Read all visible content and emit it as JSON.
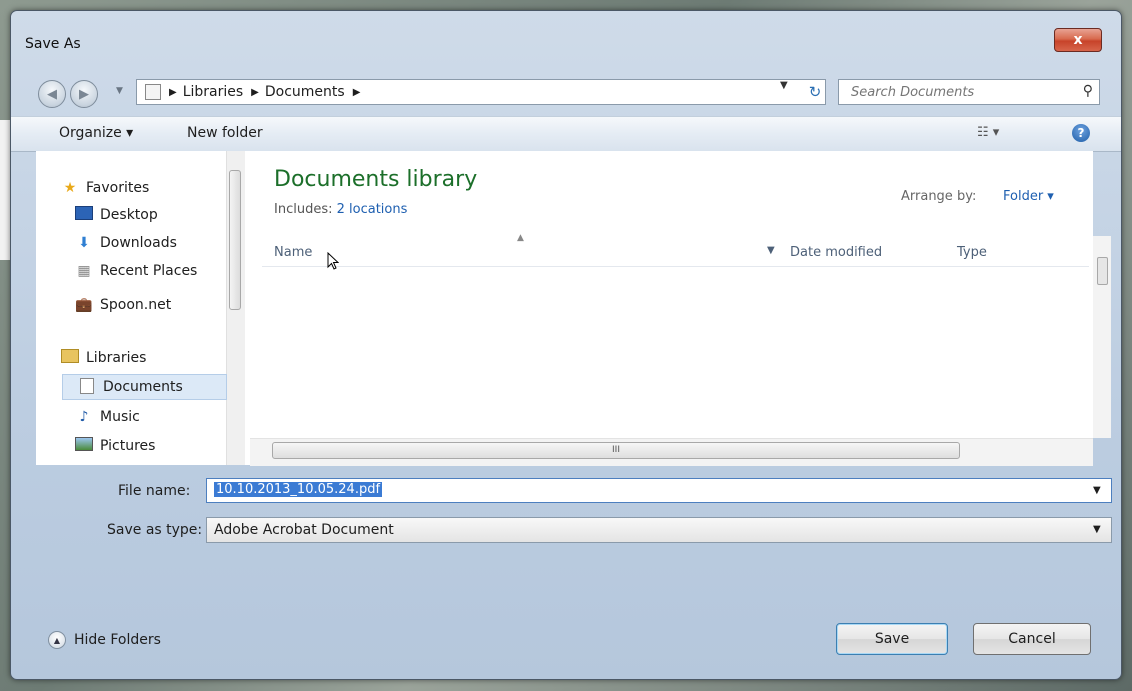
{
  "window": {
    "title": "Save As",
    "close_label": "x"
  },
  "address_bar": {
    "crumbs": [
      "Libraries",
      "Documents"
    ]
  },
  "search": {
    "placeholder": "Search Documents"
  },
  "toolbar": {
    "organize_label": "Organize ▾",
    "new_folder_label": "New folder"
  },
  "navigation": {
    "items": [
      {
        "label": "Favorites",
        "icon": "star-icon"
      },
      {
        "label": "Desktop",
        "icon": "desktop-icon"
      },
      {
        "label": "Downloads",
        "icon": "downloads-icon"
      },
      {
        "label": "Recent Places",
        "icon": "recent-places-icon"
      },
      {
        "label": "Spoon.net",
        "icon": "briefcase-icon"
      },
      {
        "label": "Libraries",
        "icon": "libraries-icon"
      },
      {
        "label": "Documents",
        "icon": "documents-icon",
        "selected": true
      },
      {
        "label": "Music",
        "icon": "music-icon"
      },
      {
        "label": "Pictures",
        "icon": "pictures-icon"
      }
    ]
  },
  "library": {
    "title": "Documents library",
    "includes_label": "Includes:",
    "includes_link": "2 locations",
    "arrange_label": "Arrange by:",
    "arrange_value": "Folder ▾"
  },
  "columns": [
    "Name",
    "Date modified",
    "Type"
  ],
  "form": {
    "file_name_label": "File name:",
    "file_name_value": "10.10.2013_10.05.24.pdf",
    "save_type_label": "Save as type:",
    "save_type_value": "Adobe Acrobat Document"
  },
  "footer": {
    "hide_folders_label": "Hide Folders",
    "save_label": "Save",
    "cancel_label": "Cancel"
  },
  "hscroll_label": "III",
  "colors": {
    "library_title": "#1c6f2a",
    "link": "#1e5fb0",
    "selection": "#3b7bd4",
    "close": "#c7432a"
  }
}
